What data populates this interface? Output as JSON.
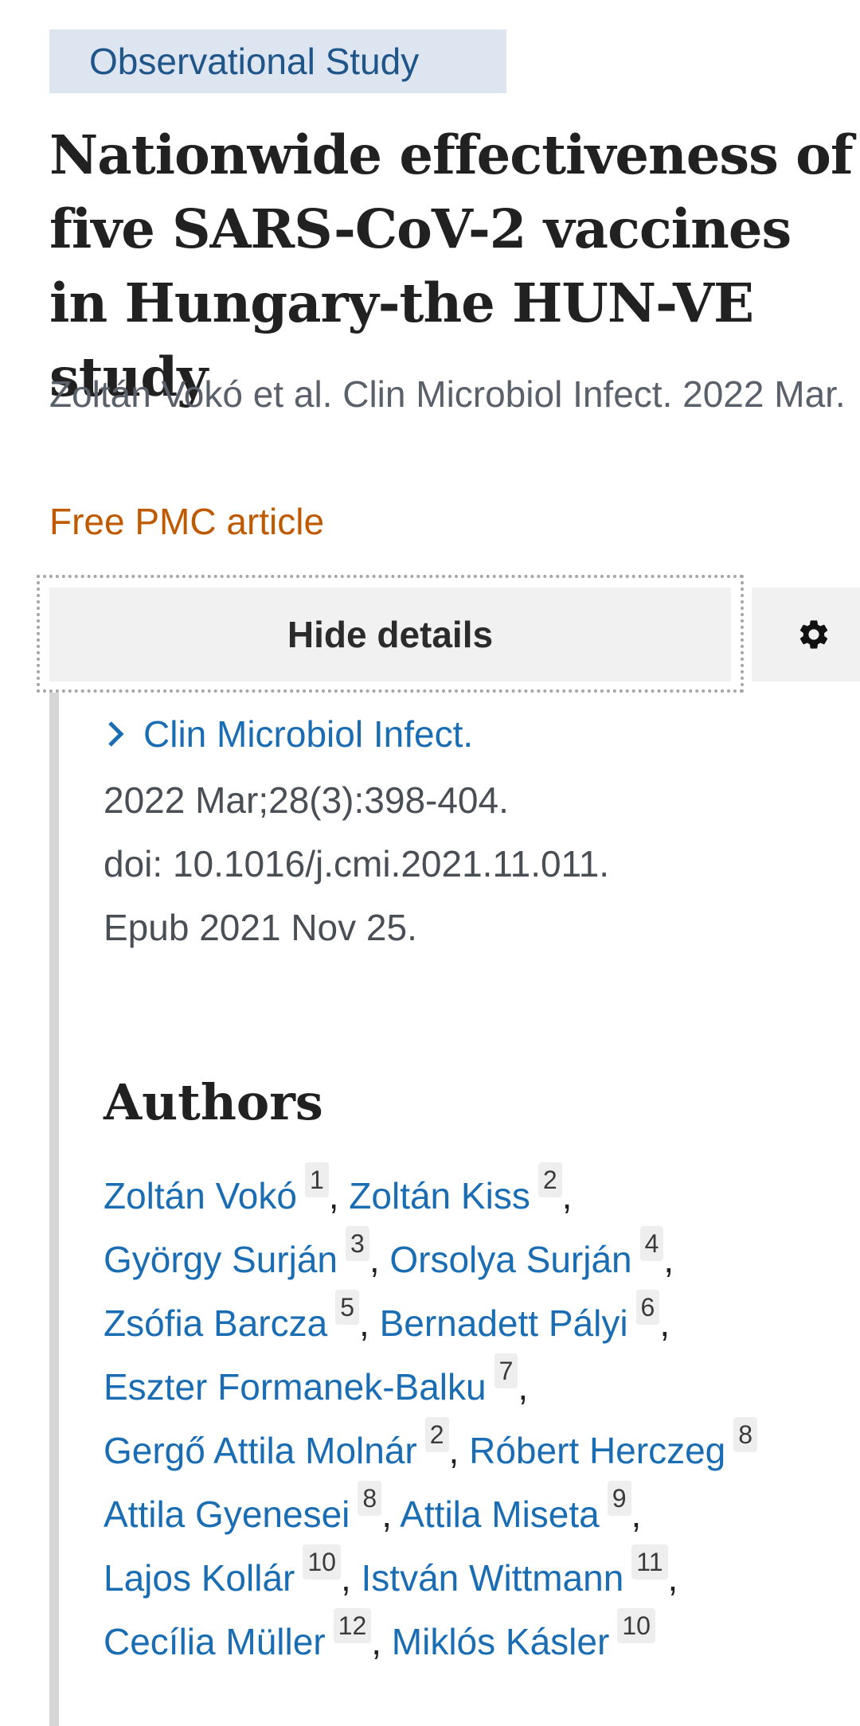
{
  "article_type": "Observational Study",
  "title": "Nationwide effectiveness of five SARS-CoV-2 vaccines in Hungary-the HUN-VE study",
  "citation": "Zoltán Vokó et al. Clin Microbiol Infect. 2022 Mar.",
  "free_pmc": "Free PMC article",
  "toggle_details": "Hide details",
  "details": {
    "journal": "Clin Microbiol Infect.",
    "volume": "2022 Mar;28(3):398-404.",
    "doi": "doi: 10.1016/j.cmi.2021.11.011.",
    "epub": "Epub 2021 Nov 25."
  },
  "authors_heading": "Authors",
  "authors": [
    {
      "name": "Zoltán Vokó",
      "aff": "1"
    },
    {
      "name": "Zoltán Kiss",
      "aff": "2"
    },
    {
      "name": "György Surján",
      "aff": "3"
    },
    {
      "name": "Orsolya Surján",
      "aff": "4"
    },
    {
      "name": "Zsófia Barcza",
      "aff": "5"
    },
    {
      "name": "Bernadett Pályi",
      "aff": "6"
    },
    {
      "name": "Eszter Formanek-Balku",
      "aff": "7"
    },
    {
      "name": "Gergő Attila Molnár",
      "aff": "2"
    },
    {
      "name": "Róbert Herczeg",
      "aff": "8"
    },
    {
      "name": "Attila Gyenesei",
      "aff": "8"
    },
    {
      "name": "Attila Miseta",
      "aff": "9"
    },
    {
      "name": "Lajos Kollár",
      "aff": "10"
    },
    {
      "name": "István Wittmann",
      "aff": "11"
    },
    {
      "name": "Cecília Müller",
      "aff": "12"
    },
    {
      "name": "Miklós Kásler",
      "aff": "10"
    }
  ],
  "icons": {
    "settings": "gear-icon",
    "journal_expand": "chevron-right-icon"
  },
  "colors": {
    "link": "#1a6db3",
    "pmc": "#bf5a00",
    "badge_bg": "#dce5f0",
    "badge_text": "#20558a"
  }
}
